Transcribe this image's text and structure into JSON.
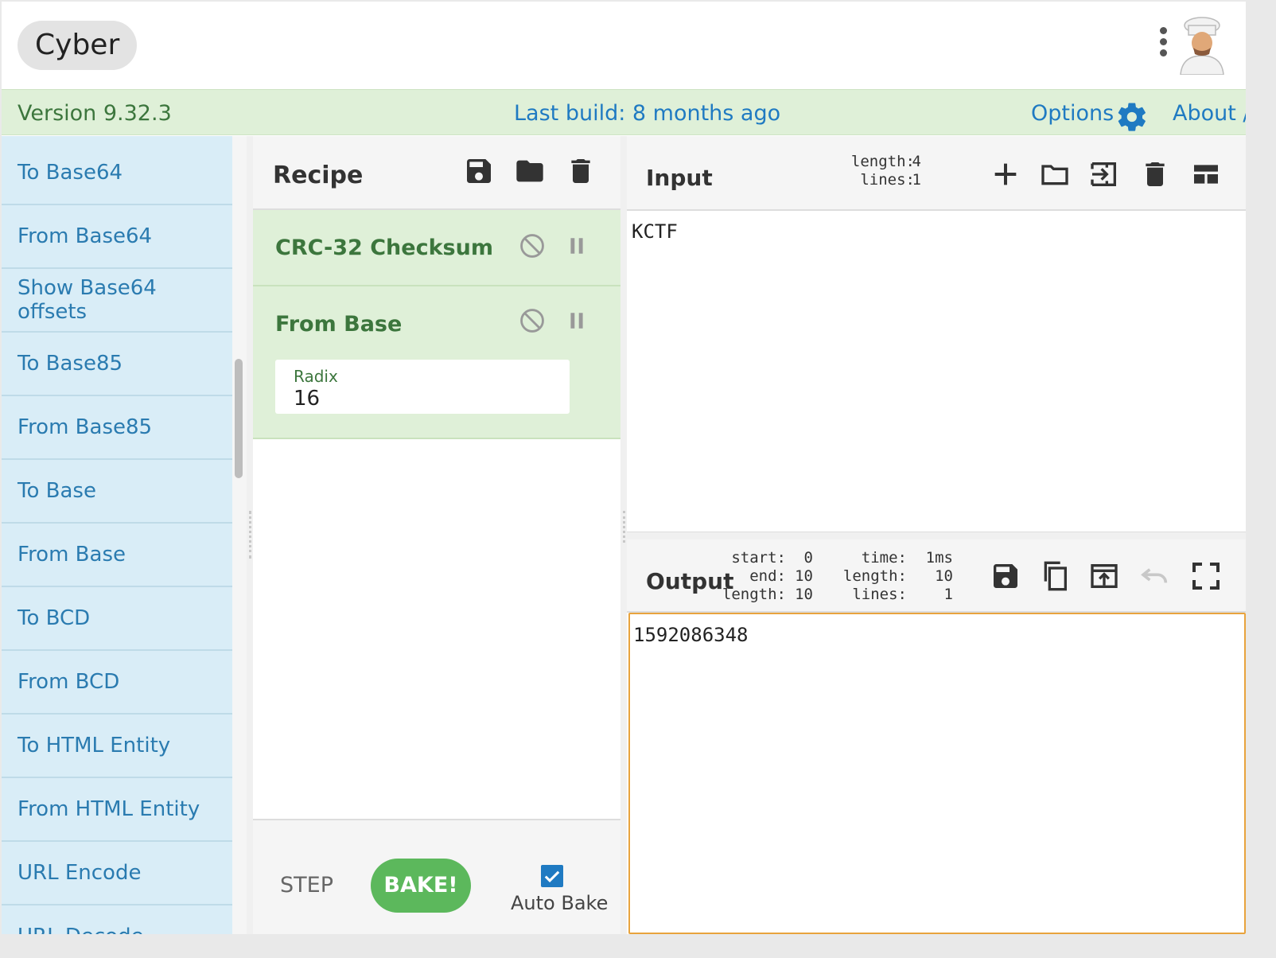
{
  "header": {
    "logo_text": "Cyber",
    "version": "Version 9.32.3",
    "last_build": "Last build: 8 months ago",
    "options_label": "Options",
    "about_label": "About /"
  },
  "operations": [
    "To Base64",
    "From Base64",
    "Show Base64 offsets",
    "To Base85",
    "From Base85",
    "To Base",
    "From Base",
    "To BCD",
    "From BCD",
    "To HTML Entity",
    "From HTML Entity",
    "URL Encode",
    "URL Decode"
  ],
  "recipe": {
    "title": "Recipe",
    "ops": [
      {
        "name": "CRC-32 Checksum"
      },
      {
        "name": "From Base",
        "arg_label": "Radix",
        "arg_value": "16"
      }
    ],
    "step_label": "STEP",
    "bake_label": "BAKE!",
    "auto_bake_label": "Auto Bake",
    "auto_bake_checked": true
  },
  "input": {
    "title": "Input",
    "length_label": "length:",
    "length_value": "4",
    "lines_label": "lines:",
    "lines_value": "1",
    "text": "KCTF"
  },
  "output": {
    "title": "Output",
    "start_label": "start:",
    "start_value": "0",
    "end_label": "end:",
    "end_value": "10",
    "sel_length_label": "length:",
    "sel_length_value": "10",
    "time_label": "time:",
    "time_value": "1ms",
    "length_label": "length:",
    "length_value": "10",
    "lines_label": "lines:",
    "lines_value": "1",
    "text": "1592086348"
  },
  "colors": {
    "accent_blue": "#1f7ac2",
    "op_green": "#3c763d",
    "bake_green": "#5cb85c",
    "output_border": "#e8a33d"
  }
}
